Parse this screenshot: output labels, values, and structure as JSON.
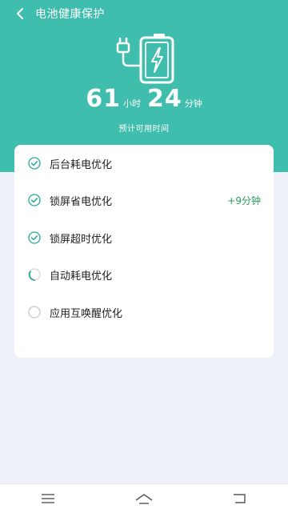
{
  "header": {
    "title": "电池健康保护"
  },
  "battery": {
    "hours_value": "61",
    "hours_unit": "小时",
    "minutes_value": "24",
    "minutes_unit": "分钟",
    "subtitle": "预计可用时间"
  },
  "optimizations": [
    {
      "label": "后台耗电优化",
      "status": "done",
      "extra": ""
    },
    {
      "label": "锁屏省电优化",
      "status": "done",
      "extra": "+9分钟"
    },
    {
      "label": "锁屏超时优化",
      "status": "done",
      "extra": ""
    },
    {
      "label": "自动耗电优化",
      "status": "in-progress",
      "extra": ""
    },
    {
      "label": "应用互唤醒优化",
      "status": "pending",
      "extra": ""
    }
  ],
  "colors": {
    "accent": "#3fbdad",
    "check": "#2aa898",
    "gain": "#2b9a5a",
    "background": "#eff1f8"
  },
  "icons": {
    "back": "chevron-left-icon",
    "done": "check-circle-icon",
    "in_progress": "loading-icon",
    "pending": "empty-circle-icon",
    "nav_menu": "menu-icon",
    "nav_home": "home-icon",
    "nav_back": "back-icon"
  }
}
